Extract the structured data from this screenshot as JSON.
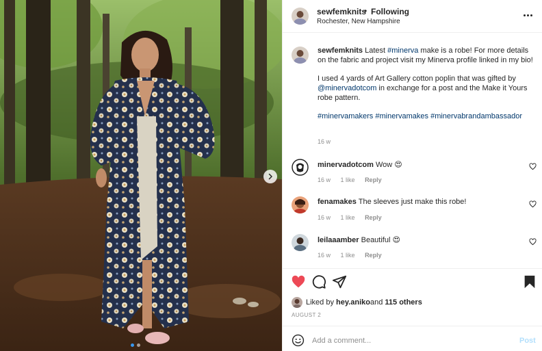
{
  "post": {
    "username": "sewfemknits",
    "separator": "•",
    "follow_status": "Following",
    "location": "Rochester, New Hampshire"
  },
  "caption": {
    "username": "sewfemknits",
    "line1_a": "Latest ",
    "line1_tag": "#minerva",
    "line1_b": " make is a robe! For more details on the fabric and project visit my Minerva profile linked in my bio!",
    "line2_a": "I used 4 yards of Art Gallery cotton poplin that was gifted by ",
    "line2_mention": "@minervadotcom",
    "line2_b": " in exchange for a post and the Make it Yours robe pattern.",
    "tag1": "#minervamakers",
    "tag2": "#minervamakes",
    "tag3": "#minervabrandambassador",
    "time": "16 w"
  },
  "comments": [
    {
      "user": "minervadotcom",
      "text": "Wow 😍",
      "time": "16 w",
      "likes": "1 like",
      "reply": "Reply"
    },
    {
      "user": "fenamakes",
      "text": "The sleeves just make this robe!",
      "time": "16 w",
      "likes": "1 like",
      "reply": "Reply"
    },
    {
      "user": "leilaaamber",
      "text": "Beautiful 😍",
      "time": "16 w",
      "likes": "1 like",
      "reply": "Reply"
    }
  ],
  "likes": {
    "prefix": "Liked by ",
    "user": "hey.aniko",
    "middle": " and ",
    "others": "115 others"
  },
  "date": "AUGUST 2",
  "add_comment": {
    "placeholder": "Add a comment...",
    "post_label": "Post"
  },
  "carousel": {
    "total": 2,
    "active": 1
  },
  "colors": {
    "like_red": "#ed4956",
    "link_blue": "#00376b",
    "post_disabled": "#b2dffc",
    "secondary_text": "#8e8e8e"
  },
  "icons": [
    "more-icon",
    "heart-icon",
    "comment-icon",
    "share-icon",
    "bookmark-icon",
    "emoji-icon",
    "chevron-right-icon"
  ]
}
